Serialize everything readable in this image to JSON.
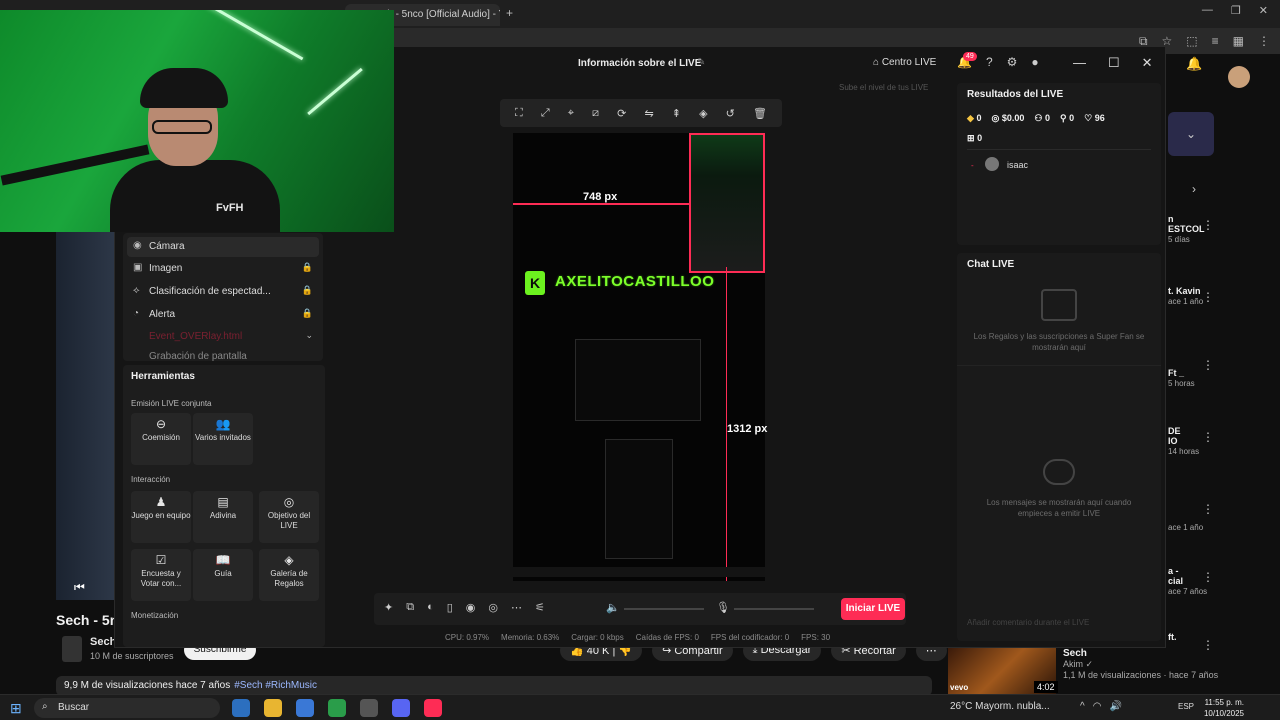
{
  "browser": {
    "tab_title": "Sech - 5nco [Official Audio] - Y",
    "window_controls": [
      "—",
      "❐",
      "✕"
    ]
  },
  "youtube": {
    "video_title": "Sech - 5nc",
    "channel": "Sech",
    "subscribers": "10 M de suscriptores",
    "subscribe_label": "Suscribirme",
    "likes": "40 K",
    "share_label": "Compartir",
    "download_label": "Descargar",
    "clip_label": "Recortar",
    "description": "9,9 M de visualizaciones  hace 7 años",
    "description_tags": "#Sech #RichMusic",
    "recommendations": [
      {
        "title": "n",
        "subtitle": "ESTCOL",
        "meta": "5 días"
      },
      {
        "title": "t. Kavin",
        "subtitle": "",
        "meta": "ace 1 año"
      },
      {
        "title": "Ft _",
        "subtitle": "",
        "meta": "5 horas"
      },
      {
        "title": "DE",
        "subtitle": "IO",
        "meta": "14 horas"
      },
      {
        "title": "",
        "subtitle": "",
        "meta": "ace 1 año"
      },
      {
        "title": "a -",
        "subtitle": "cial",
        "meta": "ace 7 años"
      },
      {
        "title": "ft.",
        "subtitle": "",
        "meta": ""
      }
    ],
    "rec_card": {
      "title": "Sech",
      "channel": "Akim",
      "meta": "1,1 M de visualizaciones · hace 7 años",
      "duration": "4:02",
      "thumb_label": "vevo"
    }
  },
  "studio": {
    "title": "Información sobre el LIVE",
    "centro_live": "Centro LIVE",
    "notification_count": "49",
    "level_hint": "Sube el nivel de tus LIVE",
    "sources": [
      {
        "label": "Cámara",
        "icon": "camera-icon",
        "locked": false
      },
      {
        "label": "Imagen",
        "icon": "image-icon",
        "locked": true
      },
      {
        "label": "Clasificación de espectad...",
        "icon": "ranking-icon",
        "locked": true
      },
      {
        "label": "Alerta",
        "icon": "bell-icon",
        "locked": true
      },
      {
        "label": "Event_OVERlay.html",
        "icon": "blur-icon",
        "locked": false
      },
      {
        "label": "Grabación de pantalla",
        "icon": "screen-icon",
        "locked": false
      }
    ],
    "tools": {
      "title": "Herramientas",
      "section_cohost": "Emisión LIVE conjunta",
      "section_interaction": "Interacción",
      "section_monetization": "Monetización",
      "cohost_items": [
        "Coemisión",
        "Varios invitados"
      ],
      "interaction_items": [
        "Juego en equipo",
        "Adivina",
        "Objetivo del LIVE",
        "Encuesta y Votar con...",
        "Guía",
        "Galería de Regalos"
      ]
    },
    "preview": {
      "width_label": "748 px",
      "height_label": "1312 px",
      "banner_text": "AXELITOCASTILLOO",
      "banner_k": "K"
    },
    "controls": {
      "start_label": "Iniciar LIVE"
    },
    "stats": [
      "CPU:  0.97%",
      "Memoria:  0.63%",
      "Cargar:  0 kbps",
      "Caídas de FPS:  0",
      "FPS del codificador:  0",
      "FPS:  30"
    ],
    "results": {
      "title": "Resultados del LIVE",
      "diamonds": "0",
      "earnings": "$0.00",
      "viewers": "0",
      "shares": "0",
      "likes": "96",
      "gifts": "0",
      "user": "isaac"
    },
    "chat": {
      "title": "Chat LIVE",
      "gifts_msg": "Los Regalos y las suscripciones a Super Fan se mostrarán aquí",
      "empty_msg": "Los mensajes se mostrarán aquí cuando empieces a emitir LIVE",
      "input_placeholder": "Añadir comentario durante el LIVE"
    }
  },
  "webcam": {
    "shirt_text": "FvFH"
  },
  "taskbar": {
    "search_placeholder": "Buscar",
    "weather": "26°C  Mayorm. nubla...",
    "language": "ESP",
    "time": "11:55 p. m.",
    "date": "10/10/2025"
  },
  "colors": {
    "accent": "#fe2c55",
    "neon_green": "#7dff2a",
    "bg": "#0f0f0f"
  }
}
